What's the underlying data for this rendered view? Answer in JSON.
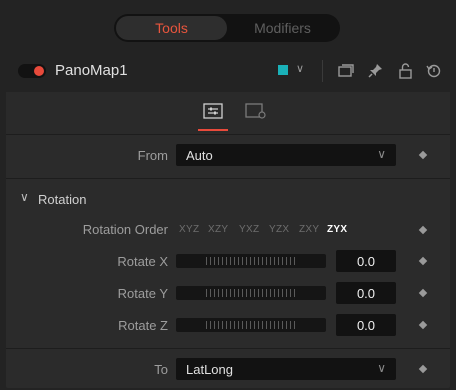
{
  "tabs": [
    {
      "label": "Tools",
      "active": true
    },
    {
      "label": "Modifiers",
      "active": false
    }
  ],
  "node": {
    "name": "PanoMap1",
    "color": "#1ab1b8"
  },
  "header_icons": [
    "window-icon",
    "pin-icon",
    "lock-icon",
    "reset-icon"
  ],
  "from": {
    "label": "From",
    "value": "Auto"
  },
  "rotation": {
    "section_title": "Rotation",
    "order_label": "Rotation Order",
    "order_options": [
      "XYZ",
      "XZY",
      "YXZ",
      "YZX",
      "ZXY",
      "ZYX"
    ],
    "order_selected": "ZYX",
    "rotate_x": {
      "label": "Rotate X",
      "value": "0.0"
    },
    "rotate_y": {
      "label": "Rotate Y",
      "value": "0.0"
    },
    "rotate_z": {
      "label": "Rotate Z",
      "value": "0.0"
    }
  },
  "to": {
    "label": "To",
    "value": "LatLong"
  },
  "colors": {
    "accent": "#e84a3b",
    "tools_tab_text": "#e8553d"
  }
}
